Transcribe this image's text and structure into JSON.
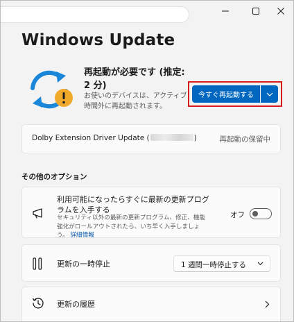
{
  "app": {
    "title": "Windows Update"
  },
  "colors": {
    "accent": "#0067c0",
    "highlight_border": "#d51b1b",
    "warning": "#f1a92c",
    "sync_blue": "#1a86d9"
  },
  "status": {
    "title": "再起動が必要です (推定: 2 分)",
    "description": "お使いのデバイスは、アクティブ時間外に再起動されます。",
    "icon": "sync-with-warning-icon",
    "restart_button_label": "今すぐ再起動する"
  },
  "pending_update": {
    "name_prefix": "Dolby Extension Driver Update (",
    "name_suffix": ")",
    "status": "再起動の保留中"
  },
  "options": {
    "section_label": "その他のオプション",
    "latest_updates": {
      "title": "利用可能になったらすぐに最新の更新プログラムを入手する",
      "description": "セキュリティ以外の最新の更新プログラム、修正、機能強化がロールアウトされたら、いち早く入手しましょう。",
      "link": "詳細情報",
      "toggle_label": "オフ",
      "toggle_on": false,
      "icon": "megaphone-icon"
    },
    "pause": {
      "title": "更新の一時停止",
      "selected": "1 週間一時停止する",
      "icon": "pause-icon"
    },
    "history": {
      "title": "更新の履歴",
      "icon": "history-icon"
    }
  }
}
